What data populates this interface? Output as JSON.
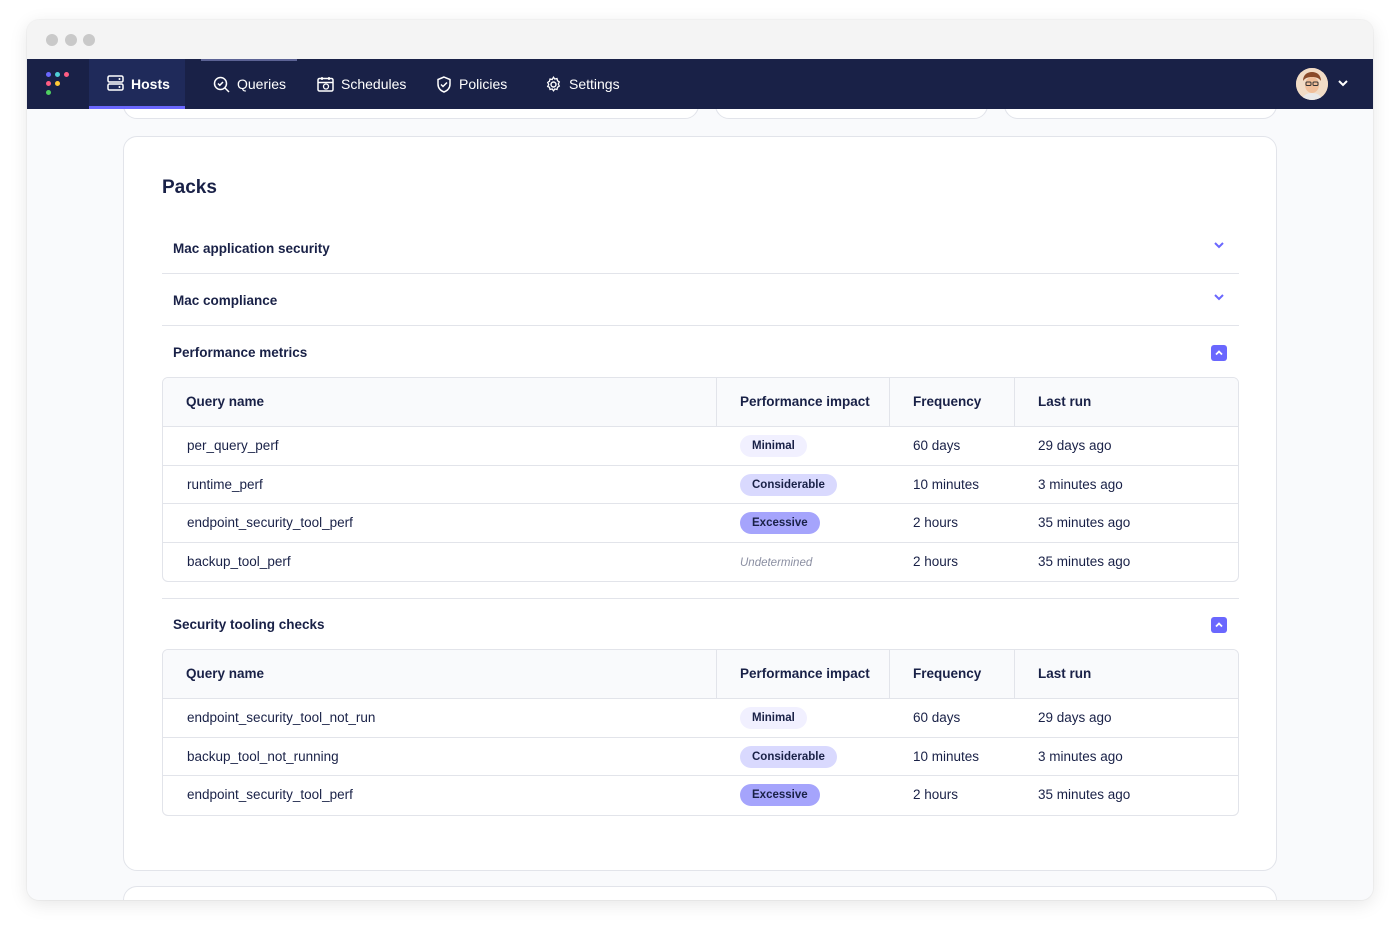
{
  "nav": {
    "items": [
      {
        "label": "Hosts",
        "icon": "hosts-icon",
        "active": true
      },
      {
        "label": "Queries",
        "icon": "queries-icon",
        "active": false
      },
      {
        "label": "Schedules",
        "icon": "schedules-icon",
        "active": false
      },
      {
        "label": "Policies",
        "icon": "policies-icon",
        "active": false
      },
      {
        "label": "Settings",
        "icon": "settings-icon",
        "active": false
      }
    ],
    "accent": "#6a67fe",
    "background": "#192147"
  },
  "packs": {
    "title": "Packs",
    "collapsed": [
      {
        "name": "Mac application security"
      },
      {
        "name": "Mac compliance"
      }
    ],
    "expanded": [
      {
        "name": "Performance metrics",
        "headers": [
          "Query name",
          "Performance impact",
          "Frequency",
          "Last run"
        ],
        "rows": [
          {
            "query": "per_query_perf",
            "impact": "Minimal",
            "frequency": "60 days",
            "last_run": "29 days ago"
          },
          {
            "query": "runtime_perf",
            "impact": "Considerable",
            "frequency": "10 minutes",
            "last_run": "3 minutes ago"
          },
          {
            "query": "endpoint_security_tool_perf",
            "impact": "Excessive",
            "frequency": "2 hours",
            "last_run": "35 minutes ago"
          },
          {
            "query": "backup_tool_perf",
            "impact": "Undetermined",
            "frequency": "2 hours",
            "last_run": "35 minutes ago"
          }
        ]
      },
      {
        "name": "Security tooling checks",
        "headers": [
          "Query name",
          "Performance impact",
          "Frequency",
          "Last run"
        ],
        "rows": [
          {
            "query": "endpoint_security_tool_not_run",
            "impact": "Minimal",
            "frequency": "60 days",
            "last_run": "29 days ago"
          },
          {
            "query": "backup_tool_not_running",
            "impact": "Considerable",
            "frequency": "10 minutes",
            "last_run": "3 minutes ago"
          },
          {
            "query": "endpoint_security_tool_perf",
            "impact": "Excessive",
            "frequency": "2 hours",
            "last_run": "35 minutes ago"
          }
        ]
      }
    ]
  },
  "impact_colors": {
    "Minimal": "#f1f0ff",
    "Considerable": "#d9d9fe",
    "Excessive": "#a5a4fc"
  }
}
